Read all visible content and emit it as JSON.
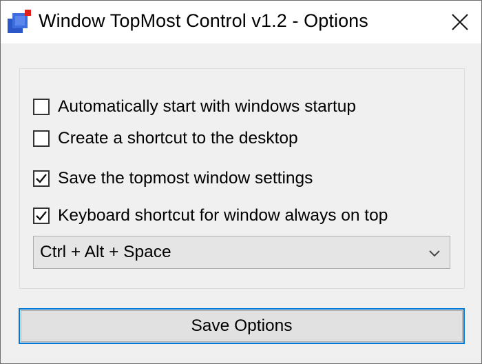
{
  "window": {
    "title": "Window TopMost Control v1.2 - Options",
    "app_icon": "window-topmost-app-icon",
    "close_icon": "close-icon"
  },
  "options": [
    {
      "label": "Automatically start with windows startup",
      "checked": false
    },
    {
      "label": "Create a shortcut to the desktop",
      "checked": false
    },
    {
      "label": "Save the topmost window settings",
      "checked": true
    },
    {
      "label": "Keyboard shortcut for window always on top",
      "checked": true
    }
  ],
  "hotkey_select": {
    "value": "Ctrl + Alt + Space",
    "icon": "chevron-down-icon"
  },
  "save_button": {
    "label": "Save Options"
  },
  "colors": {
    "accent": "#0078d7",
    "window_bg": "#f0f0f0",
    "titlebar_bg": "#ffffff",
    "icon_blue": "#2b57c8",
    "icon_red": "#e0201a"
  }
}
